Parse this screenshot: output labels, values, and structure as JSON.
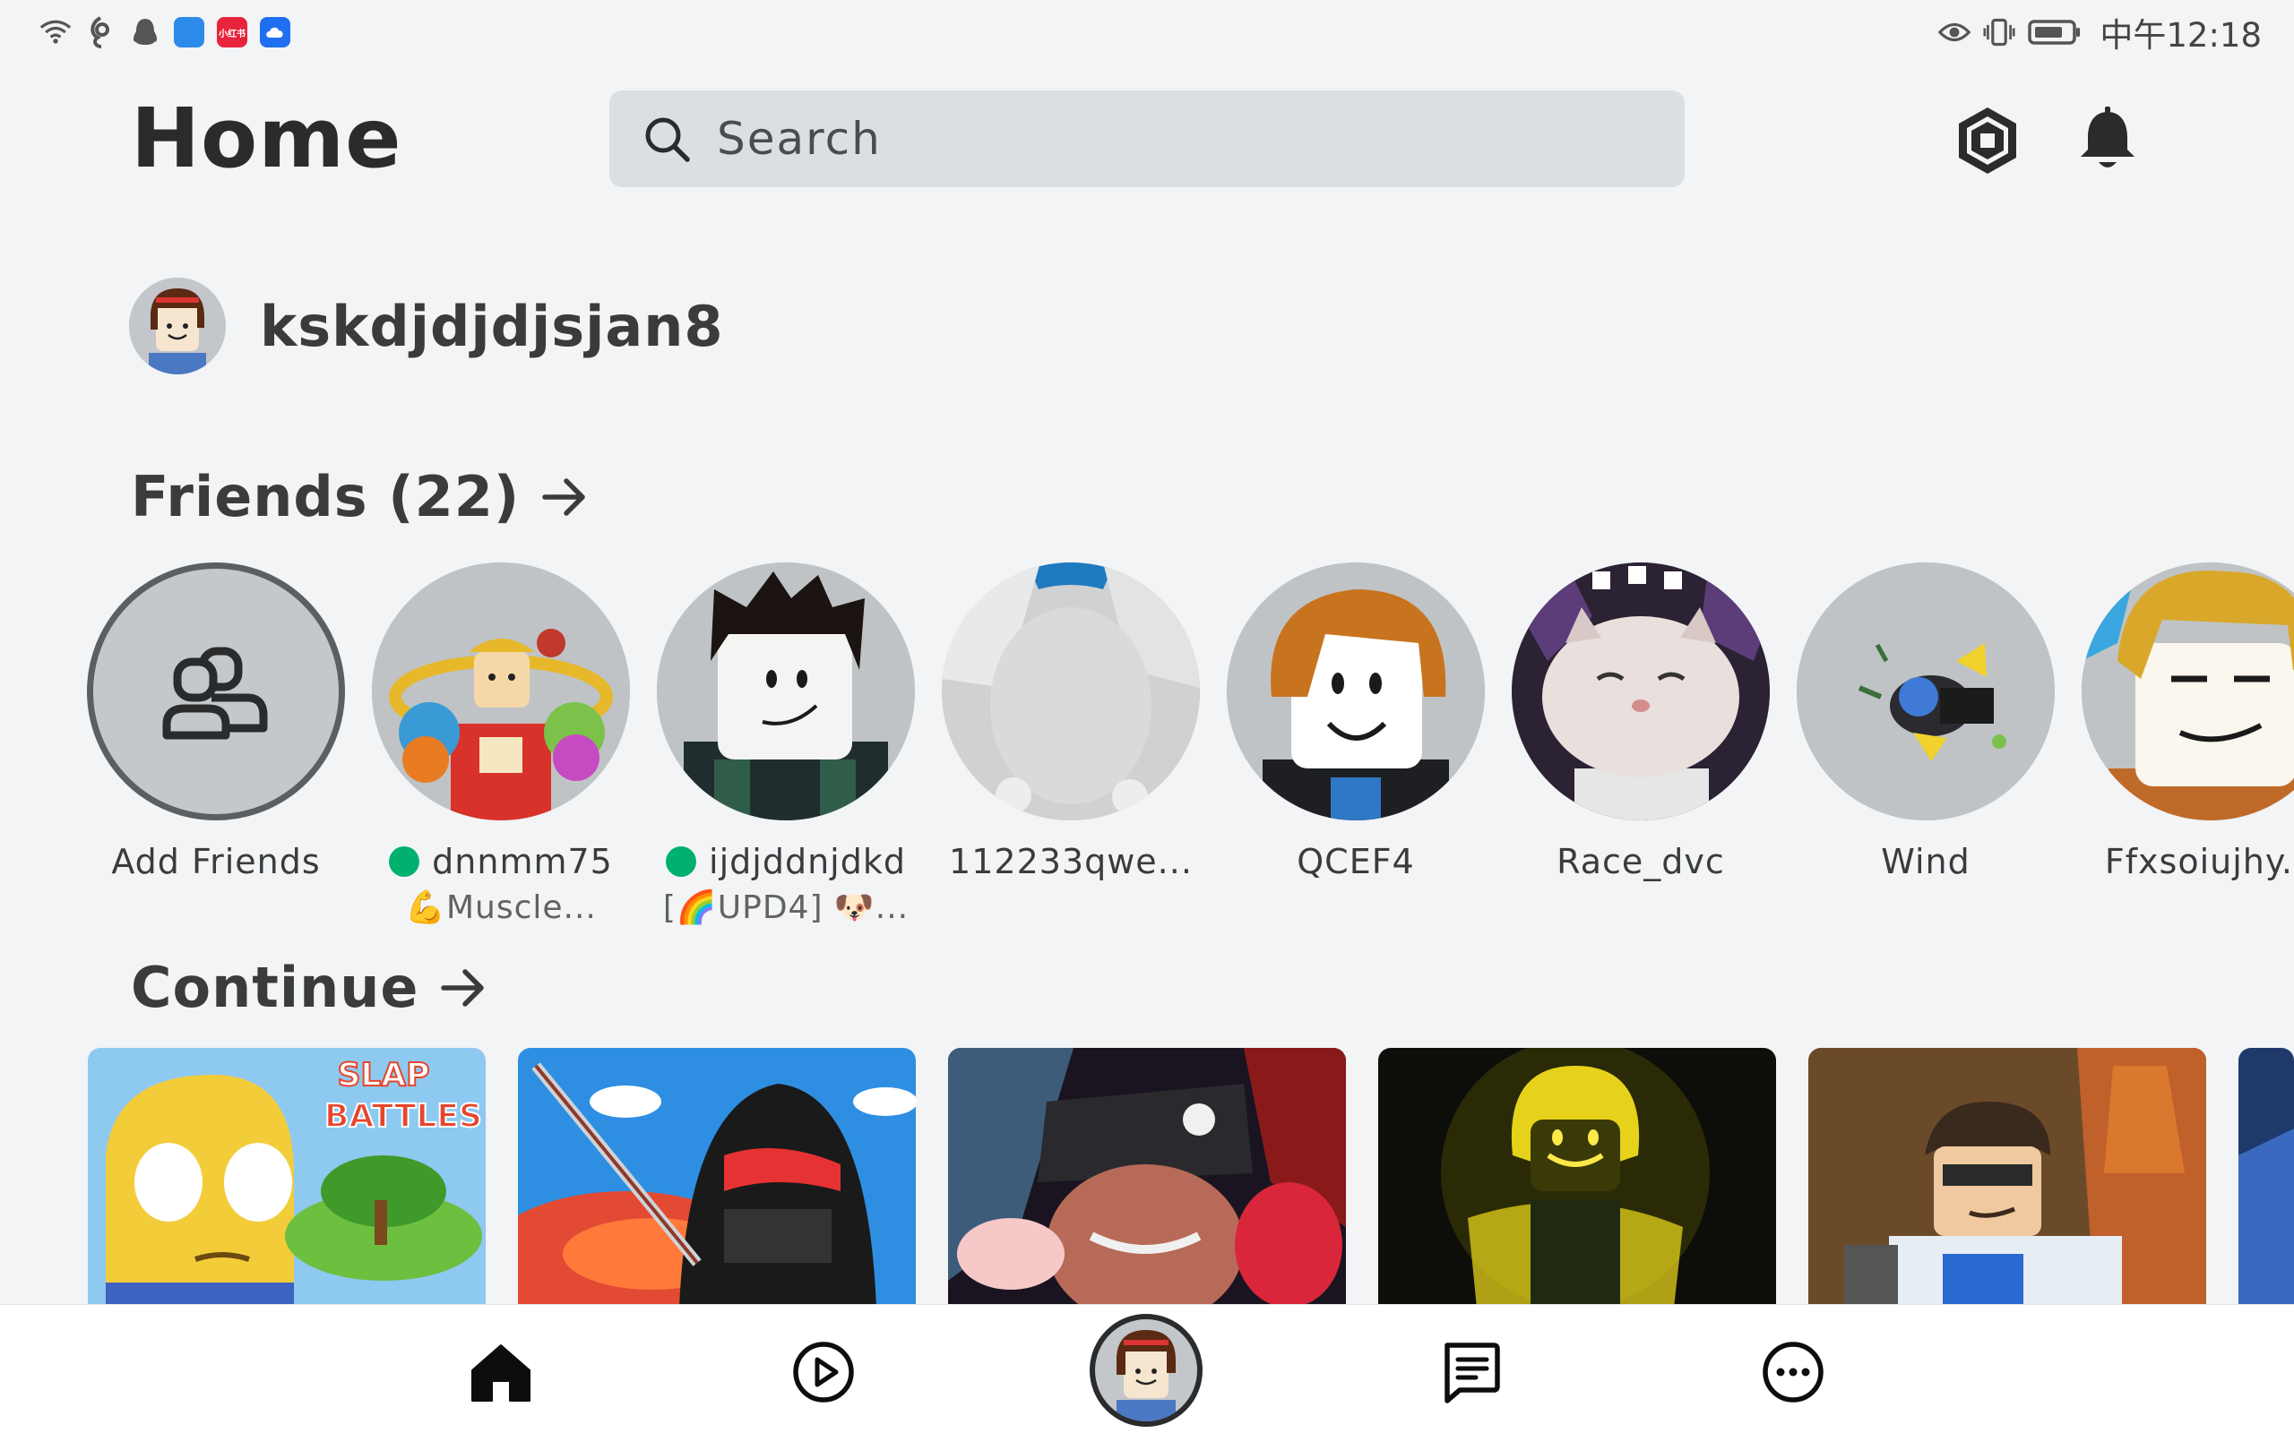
{
  "status_bar": {
    "time": "中午12:18",
    "left_icons": [
      "wifi-icon",
      "notification-app-icon",
      "qq-icon",
      "app-icon-blue",
      "app-icon-red",
      "app-icon-cloud"
    ],
    "app_badges": [
      "",
      "小红书",
      ""
    ],
    "right_icons": [
      "eye-icon",
      "vibrate-icon",
      "battery-icon"
    ]
  },
  "header": {
    "title": "Home",
    "search_placeholder": "Search",
    "robux_icon": "robux-icon",
    "notifications_icon": "bell-icon"
  },
  "profile": {
    "username": "kskdjdjdjsjan8"
  },
  "friends": {
    "header": "Friends (22)",
    "add_label": "Add Friends",
    "items": [
      {
        "name": "dnnmm75",
        "online": true,
        "status": "💪Muscle..."
      },
      {
        "name": "ijdjddnjdkd",
        "online": true,
        "status": "[🌈UPD4] 🐶..."
      },
      {
        "name": "112233qwe...",
        "online": false,
        "status": ""
      },
      {
        "name": "QCEF4",
        "online": false,
        "status": ""
      },
      {
        "name": "Race_dvc",
        "online": false,
        "status": ""
      },
      {
        "name": "Wind",
        "online": false,
        "status": ""
      },
      {
        "name": "Ffxsoiujhy...",
        "online": false,
        "status": ""
      }
    ]
  },
  "continue": {
    "header": "Continue",
    "tile_logo": [
      "SLAP",
      "BATTLES"
    ]
  },
  "bottom_nav": {
    "items": [
      "home-icon",
      "play-icon",
      "avatar-icon",
      "chat-icon",
      "more-icon"
    ]
  },
  "colors": {
    "background": "#f2f4f5",
    "text": "#393b3d",
    "online": "#00b06f",
    "search_bg": "#dcdfe1"
  }
}
